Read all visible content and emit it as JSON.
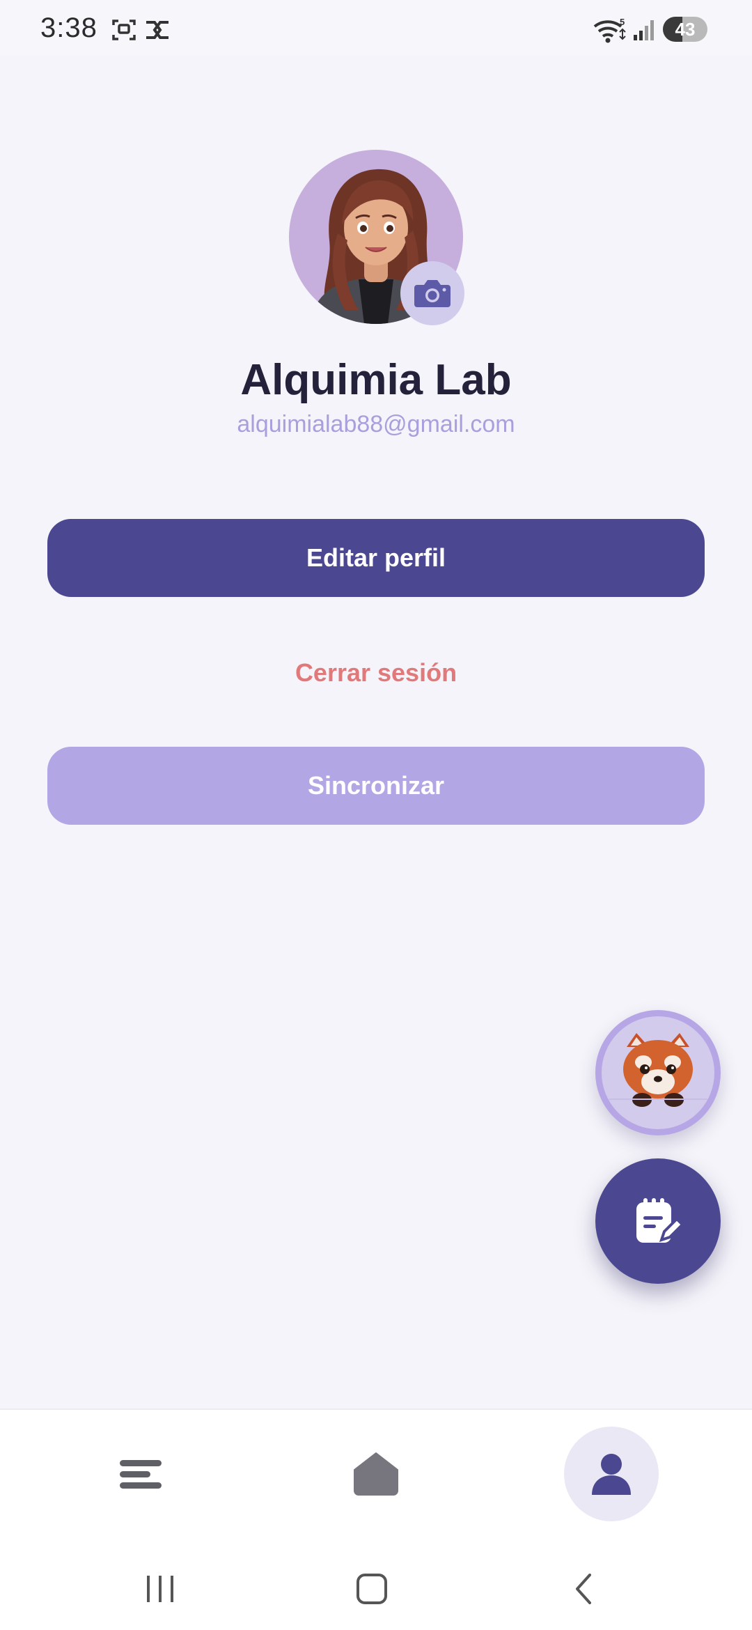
{
  "status_bar": {
    "time": "3:38",
    "battery": "43",
    "icons": [
      "screenshot-icon",
      "capcut-icon",
      "wifi-icon",
      "signal-icon",
      "battery-icon"
    ]
  },
  "profile": {
    "avatar": "avatar",
    "name": "Alquimia Lab",
    "email": "alquimialab88@gmail.com",
    "camera_icon": "camera-icon"
  },
  "actions": {
    "edit_label": "Editar perfil",
    "logout_label": "Cerrar sesión",
    "sync_label": "Sincronizar"
  },
  "fabs": {
    "mascot_icon": "red-panda-icon",
    "notes_icon": "notes-edit-icon"
  },
  "bottom_nav": {
    "items": [
      {
        "icon": "menu-icon",
        "active": false
      },
      {
        "icon": "home-icon",
        "active": false
      },
      {
        "icon": "profile-icon",
        "active": true
      }
    ]
  },
  "system_nav": {
    "icons": [
      "recent-apps-icon",
      "home-button-icon",
      "back-icon"
    ]
  },
  "colors": {
    "background": "#f5f4fa",
    "primary": "#4b4891",
    "secondary": "#b3a6e4",
    "logout": "#e07a7a",
    "email": "#a99fdc",
    "name": "#23223a"
  }
}
